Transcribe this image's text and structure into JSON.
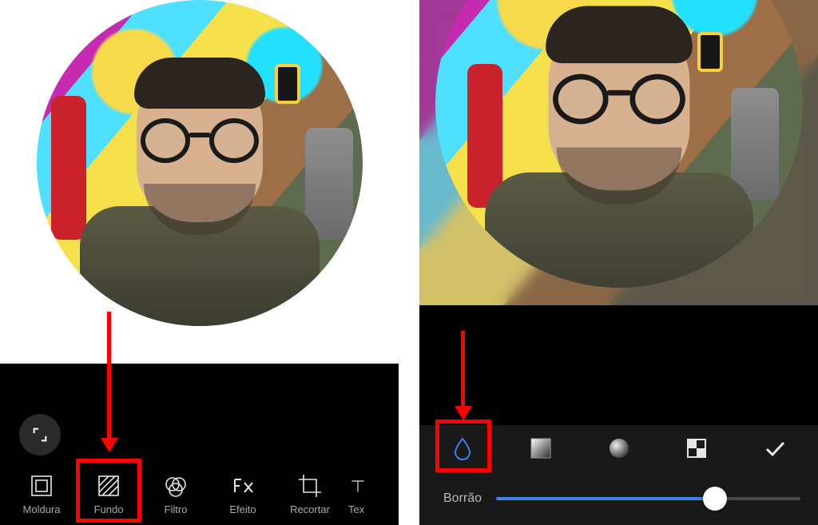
{
  "screen1": {
    "toolbar": [
      {
        "id": "moldura",
        "label": "Moldura",
        "icon": "frame-icon"
      },
      {
        "id": "fundo",
        "label": "Fundo",
        "icon": "hatch-icon"
      },
      {
        "id": "filtro",
        "label": "Filtro",
        "icon": "venn-icon"
      },
      {
        "id": "efeito",
        "label": "Efeito",
        "icon": "fx-icon"
      },
      {
        "id": "recortar",
        "label": "Recortar",
        "icon": "crop-icon"
      },
      {
        "id": "texto",
        "label": "Tex",
        "icon": "text-icon"
      }
    ],
    "expand_icon": "expand-icon",
    "highlighted_tab_index": 1
  },
  "screen2": {
    "toolbar_icons": [
      {
        "id": "blur",
        "icon": "drop-icon",
        "active": true
      },
      {
        "id": "vignette",
        "icon": "gradient-square-icon",
        "active": false
      },
      {
        "id": "sphere",
        "icon": "sphere-icon",
        "active": false
      },
      {
        "id": "pattern",
        "icon": "checker-icon",
        "active": false
      },
      {
        "id": "confirm",
        "icon": "check-icon",
        "active": false
      }
    ],
    "slider": {
      "label": "Borrão",
      "value_pct": 72
    },
    "highlighted_icon_index": 0
  },
  "colors": {
    "annotation_red": "#ff0000",
    "accent_blue": "#3a82f0"
  }
}
